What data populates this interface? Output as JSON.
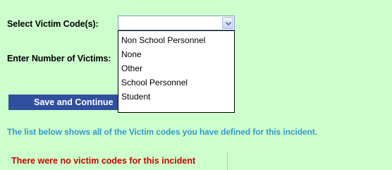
{
  "form": {
    "victim_code_label": "Select Victim Code(s):",
    "number_label": "Enter Number of Victims:",
    "select_value": "",
    "dropdown_options": [
      "Non School Personnel",
      "None",
      "Other",
      "School Personnel",
      "Student"
    ],
    "save_button_label": "Save and Continue"
  },
  "info_text": "The list below shows all of the Victim codes you have defined for this incident.",
  "no_codes_message": "There were no victim codes for this incident",
  "colors": {
    "page_background": "#ccffcc",
    "button_background": "#2f4f9f",
    "info_text": "#3399cc",
    "error_text": "#cc0000"
  }
}
